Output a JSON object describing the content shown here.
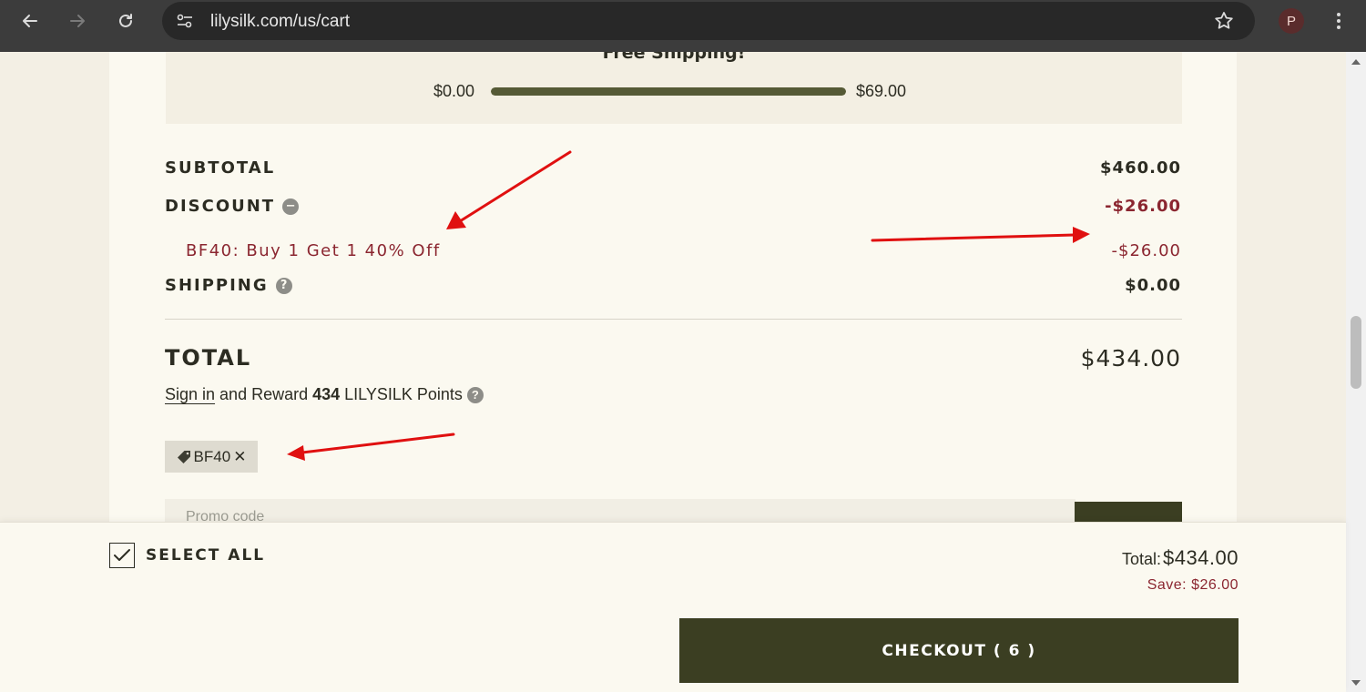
{
  "browser": {
    "url": "lilysilk.com/us/cart",
    "profile_initial": "P"
  },
  "shipping": {
    "title": "Free Shipping!",
    "min_label": "$0.00",
    "max_label": "$69.00",
    "progress_fraction": 1.0
  },
  "summary": {
    "subtotal_label": "SUBTOTAL",
    "subtotal_value": "$460.00",
    "discount_label": "DISCOUNT",
    "discount_value": "-$26.00",
    "discount_detail_label": "BF40: Buy 1 Get 1 40% Off",
    "discount_detail_value": "-$26.00",
    "shipping_label": "SHIPPING",
    "shipping_value": "$0.00",
    "total_label": "TOTAL",
    "total_value": "$434.00"
  },
  "reward": {
    "sign_in": "Sign in",
    "text_before": "and Reward",
    "points": "434",
    "text_after": "LILYSILK Points"
  },
  "coupon": {
    "code": "BF40",
    "remove_glyph": "✕"
  },
  "promo": {
    "placeholder": "Promo code"
  },
  "bottom_bar": {
    "select_all_label": "SELECT ALL",
    "select_all_checked": true,
    "total_label": "Total:",
    "total_value": "$434.00",
    "save_text": "Save: $26.00",
    "checkout_label": "CHECKOUT ( 6 )"
  },
  "colors": {
    "accent_dark": "#3b3e22",
    "discount_red": "#8b2630",
    "annotation_arrow": "#e01010"
  }
}
